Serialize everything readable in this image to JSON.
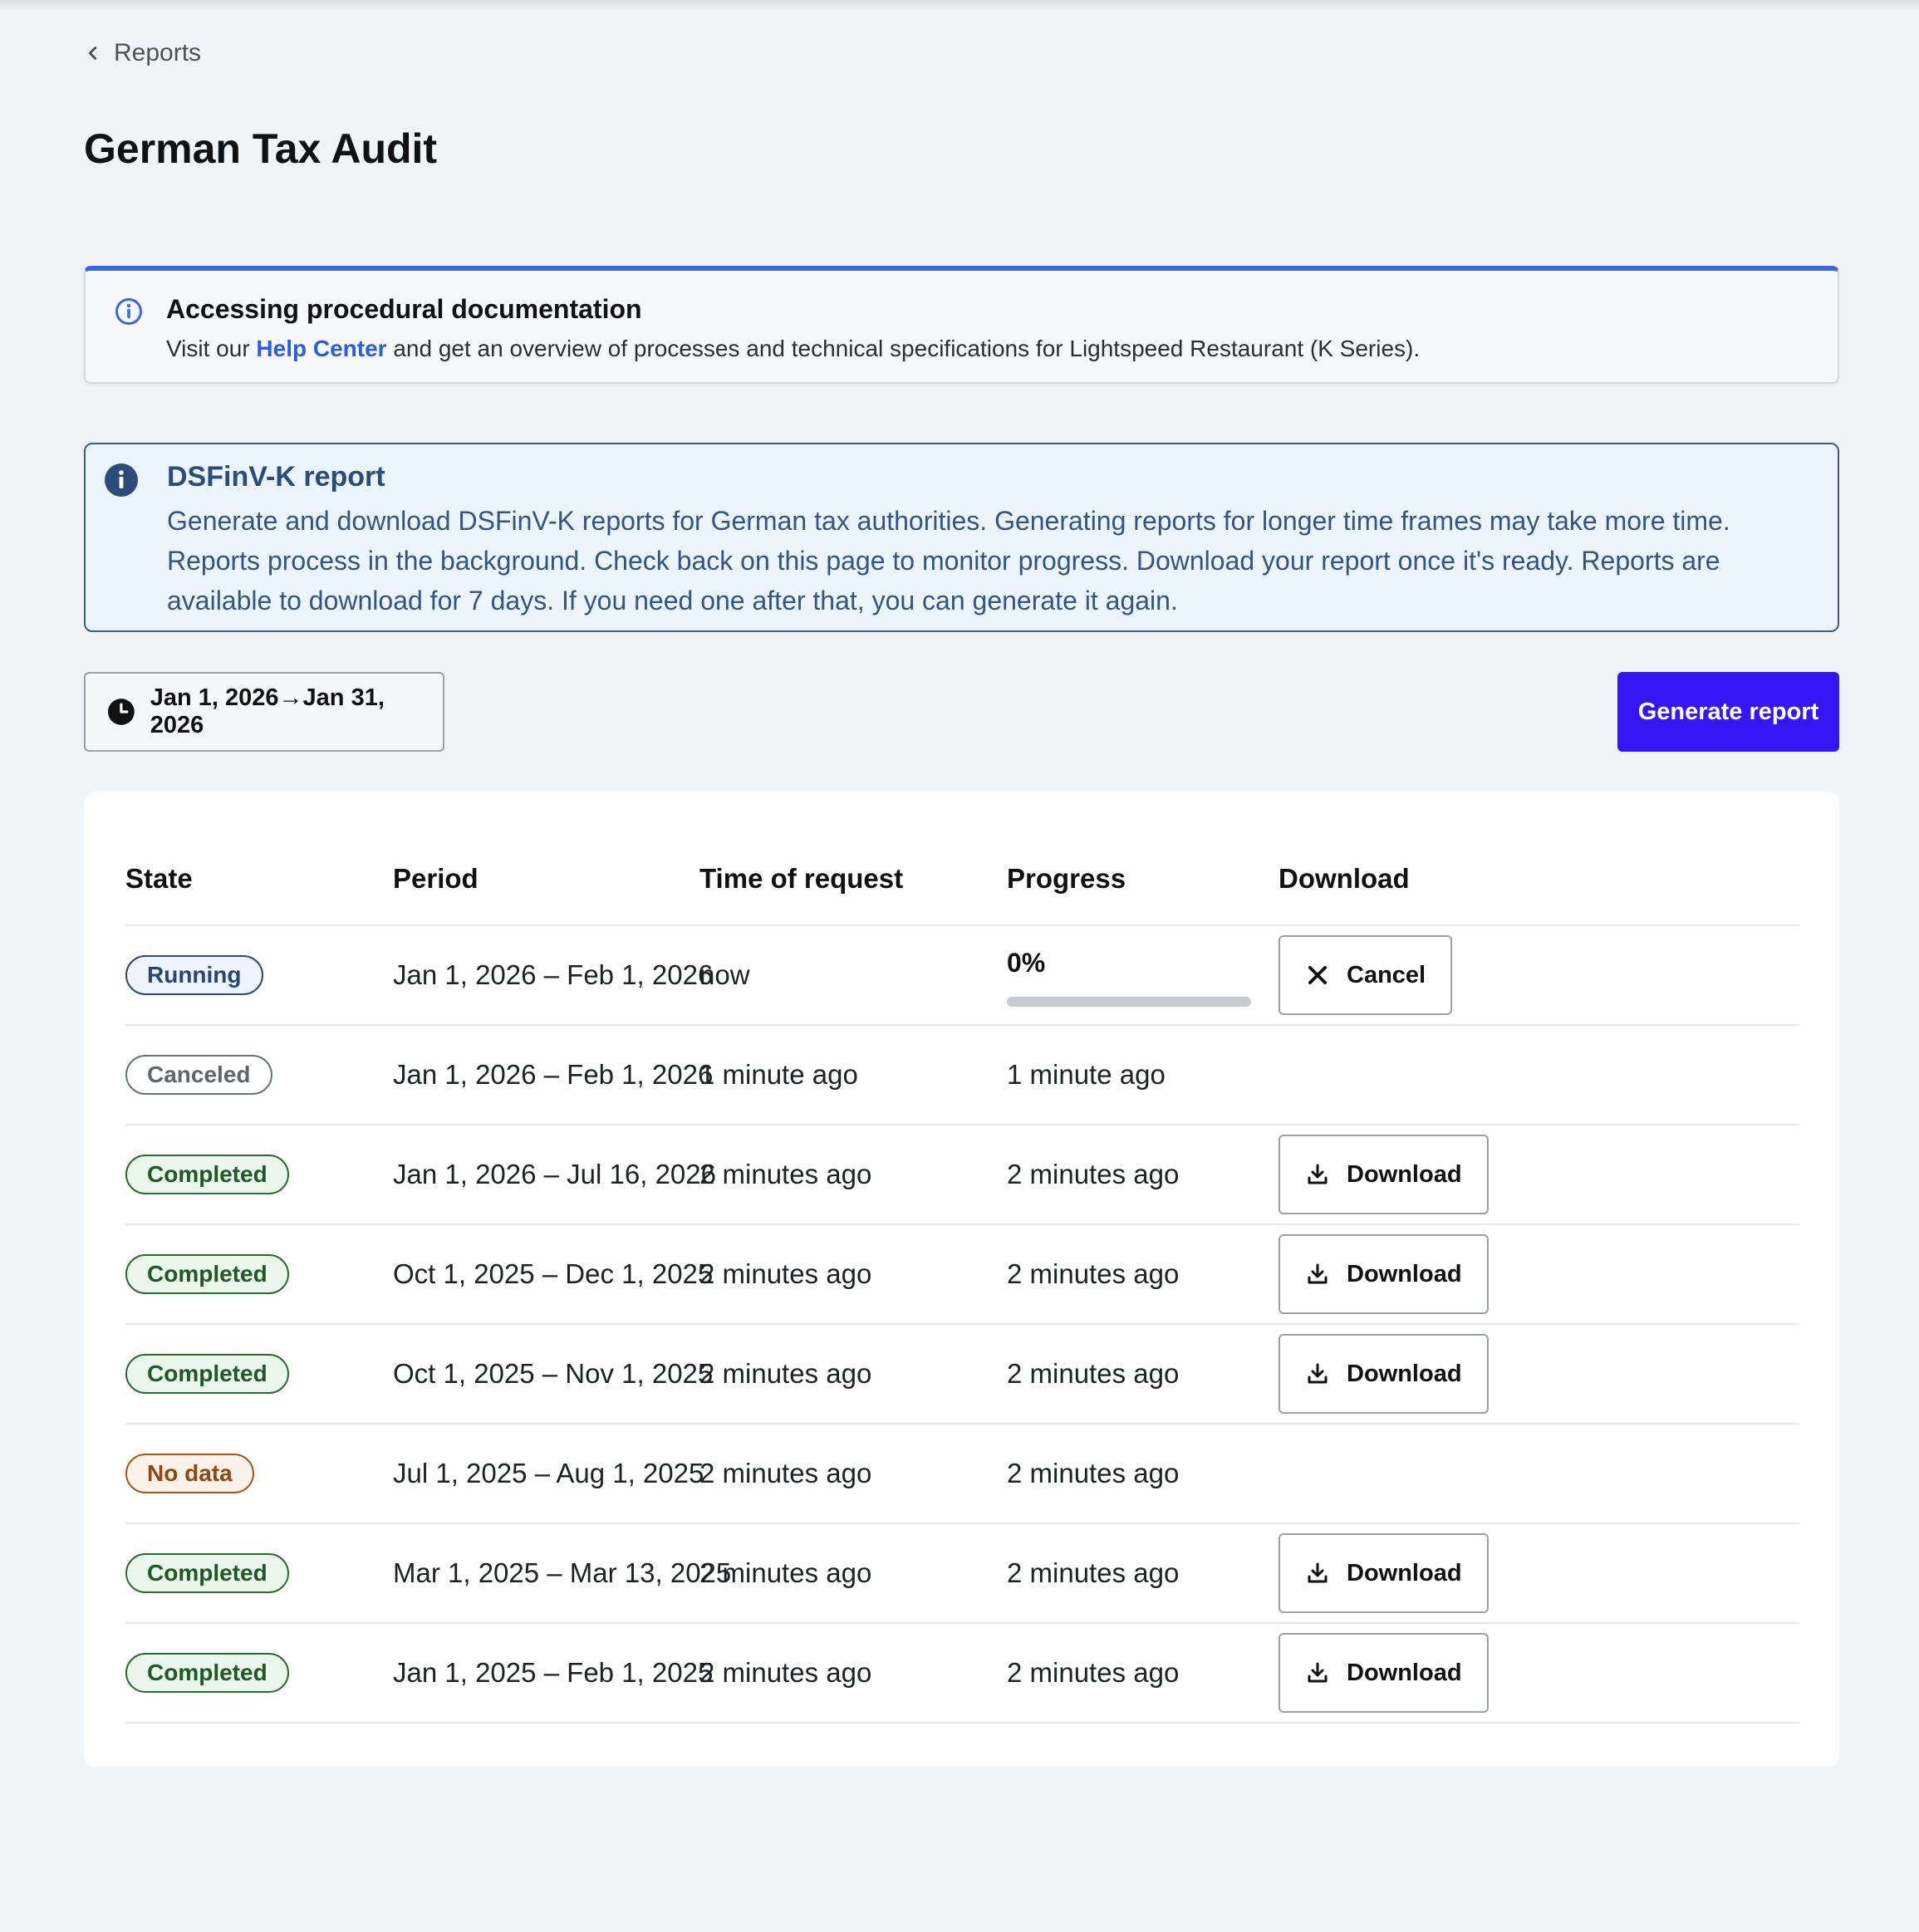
{
  "breadcrumb": {
    "label": "Reports"
  },
  "page": {
    "title": "German Tax Audit"
  },
  "help_banner": {
    "title": "Accessing procedural documentation",
    "text_before": "Visit our ",
    "link_label": "Help Center",
    "text_after": " and get an overview of processes and technical specifications for Lightspeed Restaurant (K Series)."
  },
  "dsf_banner": {
    "title": "DSFinV-K report",
    "body": "Generate and download DSFinV-K reports for German tax authorities. Generating reports for longer time frames may take more time. Reports process in the background. Check back on this page to monitor progress. Download your report once it's ready. Reports are available to download for 7 days. If you need one after that, you can generate it again."
  },
  "controls": {
    "date_range": "Jan 1, 2026→Jan 31, 2026",
    "generate_label": "Generate report"
  },
  "colors": {
    "accent": "#3716f5",
    "info_border": "#3a68e0",
    "completed": "#1f5a26",
    "no_data": "#8f4612"
  },
  "table": {
    "headers": {
      "state": "State",
      "period": "Period",
      "time": "Time of request",
      "progress": "Progress",
      "download": "Download"
    },
    "rows": [
      {
        "state": "Running",
        "state_kind": "running",
        "period": "Jan 1, 2026 – Feb 1, 2026",
        "time": "now",
        "progress_text": "0%",
        "progress_fraction": 0,
        "action": "Cancel",
        "action_icon": "close-icon"
      },
      {
        "state": "Canceled",
        "state_kind": "canceled",
        "period": "Jan 1, 2026 – Feb 1, 2026",
        "time": "1 minute ago",
        "progress_text": "1 minute ago",
        "action": "",
        "action_icon": ""
      },
      {
        "state": "Completed",
        "state_kind": "completed",
        "period": "Jan 1, 2026 – Jul 16, 2026",
        "time": "2 minutes ago",
        "progress_text": "2 minutes ago",
        "action": "Download",
        "action_icon": "download-icon"
      },
      {
        "state": "Completed",
        "state_kind": "completed",
        "period": "Oct 1, 2025 – Dec 1, 2025",
        "time": "2 minutes ago",
        "progress_text": "2 minutes ago",
        "action": "Download",
        "action_icon": "download-icon"
      },
      {
        "state": "Completed",
        "state_kind": "completed",
        "period": "Oct 1, 2025 – Nov 1, 2025",
        "time": "2 minutes ago",
        "progress_text": "2 minutes ago",
        "action": "Download",
        "action_icon": "download-icon"
      },
      {
        "state": "No data",
        "state_kind": "nodata",
        "period": "Jul 1, 2025 – Aug 1, 2025",
        "time": "2 minutes ago",
        "progress_text": "2 minutes ago",
        "action": "",
        "action_icon": ""
      },
      {
        "state": "Completed",
        "state_kind": "completed",
        "period": "Mar 1, 2025 – Mar 13, 2025",
        "time": "2 minutes ago",
        "progress_text": "2 minutes ago",
        "action": "Download",
        "action_icon": "download-icon"
      },
      {
        "state": "Completed",
        "state_kind": "completed",
        "period": "Jan 1, 2025 – Feb 1, 2025",
        "time": "2 minutes ago",
        "progress_text": "2 minutes ago",
        "action": "Download",
        "action_icon": "download-icon"
      }
    ]
  }
}
